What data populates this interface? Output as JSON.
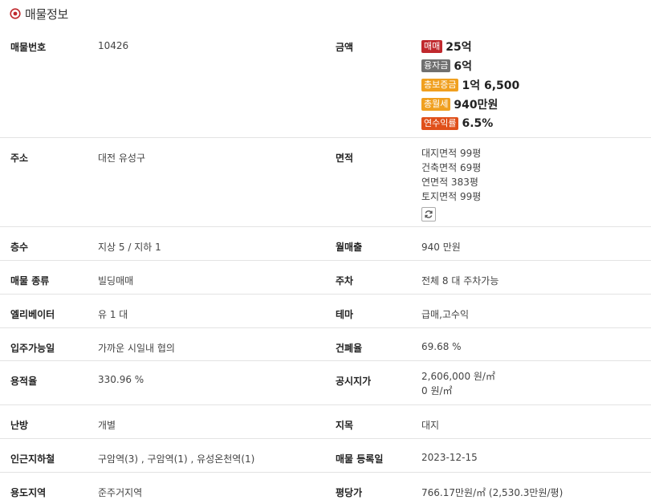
{
  "header": {
    "title": "매물정보"
  },
  "price": {
    "label": "금액",
    "items": [
      {
        "badge": "매매",
        "value": "25억",
        "color": "#c0282d"
      },
      {
        "badge": "융자금",
        "value": "6억",
        "color": "#707070"
      },
      {
        "badge": "총보증금",
        "value": "1억 6,500",
        "color": "#f0a020"
      },
      {
        "badge": "총월세",
        "value": "940만원",
        "color": "#f0a020"
      },
      {
        "badge": "연수익률",
        "value": "6.5%",
        "color": "#e0501a"
      }
    ]
  },
  "rows": {
    "listing_no": {
      "label": "매물번호",
      "value": "10426"
    },
    "address": {
      "label": "주소",
      "value": "대전 유성구"
    },
    "area": {
      "label": "면적",
      "lines": [
        "대지면적 99평",
        "건축면적 69평",
        "연면적 383평",
        "토지면적 99평"
      ]
    },
    "floors": {
      "label": "층수",
      "value": "지상 5 / 지하 1"
    },
    "monthly_sales": {
      "label": "월매출",
      "value": "940 만원"
    },
    "type": {
      "label": "매물 종류",
      "value": "빌딩매매"
    },
    "parking": {
      "label": "주차",
      "value": "전체 8 대 주차가능"
    },
    "elevator": {
      "label": "엘리베이터",
      "value": "유 1 대"
    },
    "theme": {
      "label": "테마",
      "value": "급매,고수익"
    },
    "move_in": {
      "label": "입주가능일",
      "value": "가까운 시일내 협의"
    },
    "coverage": {
      "label": "건폐율",
      "value": "69.68 %"
    },
    "far": {
      "label": "용적율",
      "value": "330.96 %"
    },
    "official_price": {
      "label": "공시지가",
      "lines": [
        "2,606,000 원/㎡",
        "0 원/㎡"
      ]
    },
    "heating": {
      "label": "난방",
      "value": "개별"
    },
    "land_category": {
      "label": "지목",
      "value": "대지"
    },
    "subway": {
      "label": "인근지하철",
      "value": "구암역(3) , 구암역(1) , 유성온천역(1)"
    },
    "reg_date": {
      "label": "매물 등록일",
      "value": "2023-12-15"
    },
    "zoning": {
      "label": "용도지역",
      "value": "준주거지역"
    },
    "price_per_pyeong": {
      "label": "평당가",
      "value": "766.17만원/㎡ (2,530.3만원/평)"
    }
  },
  "icons": {
    "header": "target-icon",
    "refresh": "refresh-icon"
  }
}
